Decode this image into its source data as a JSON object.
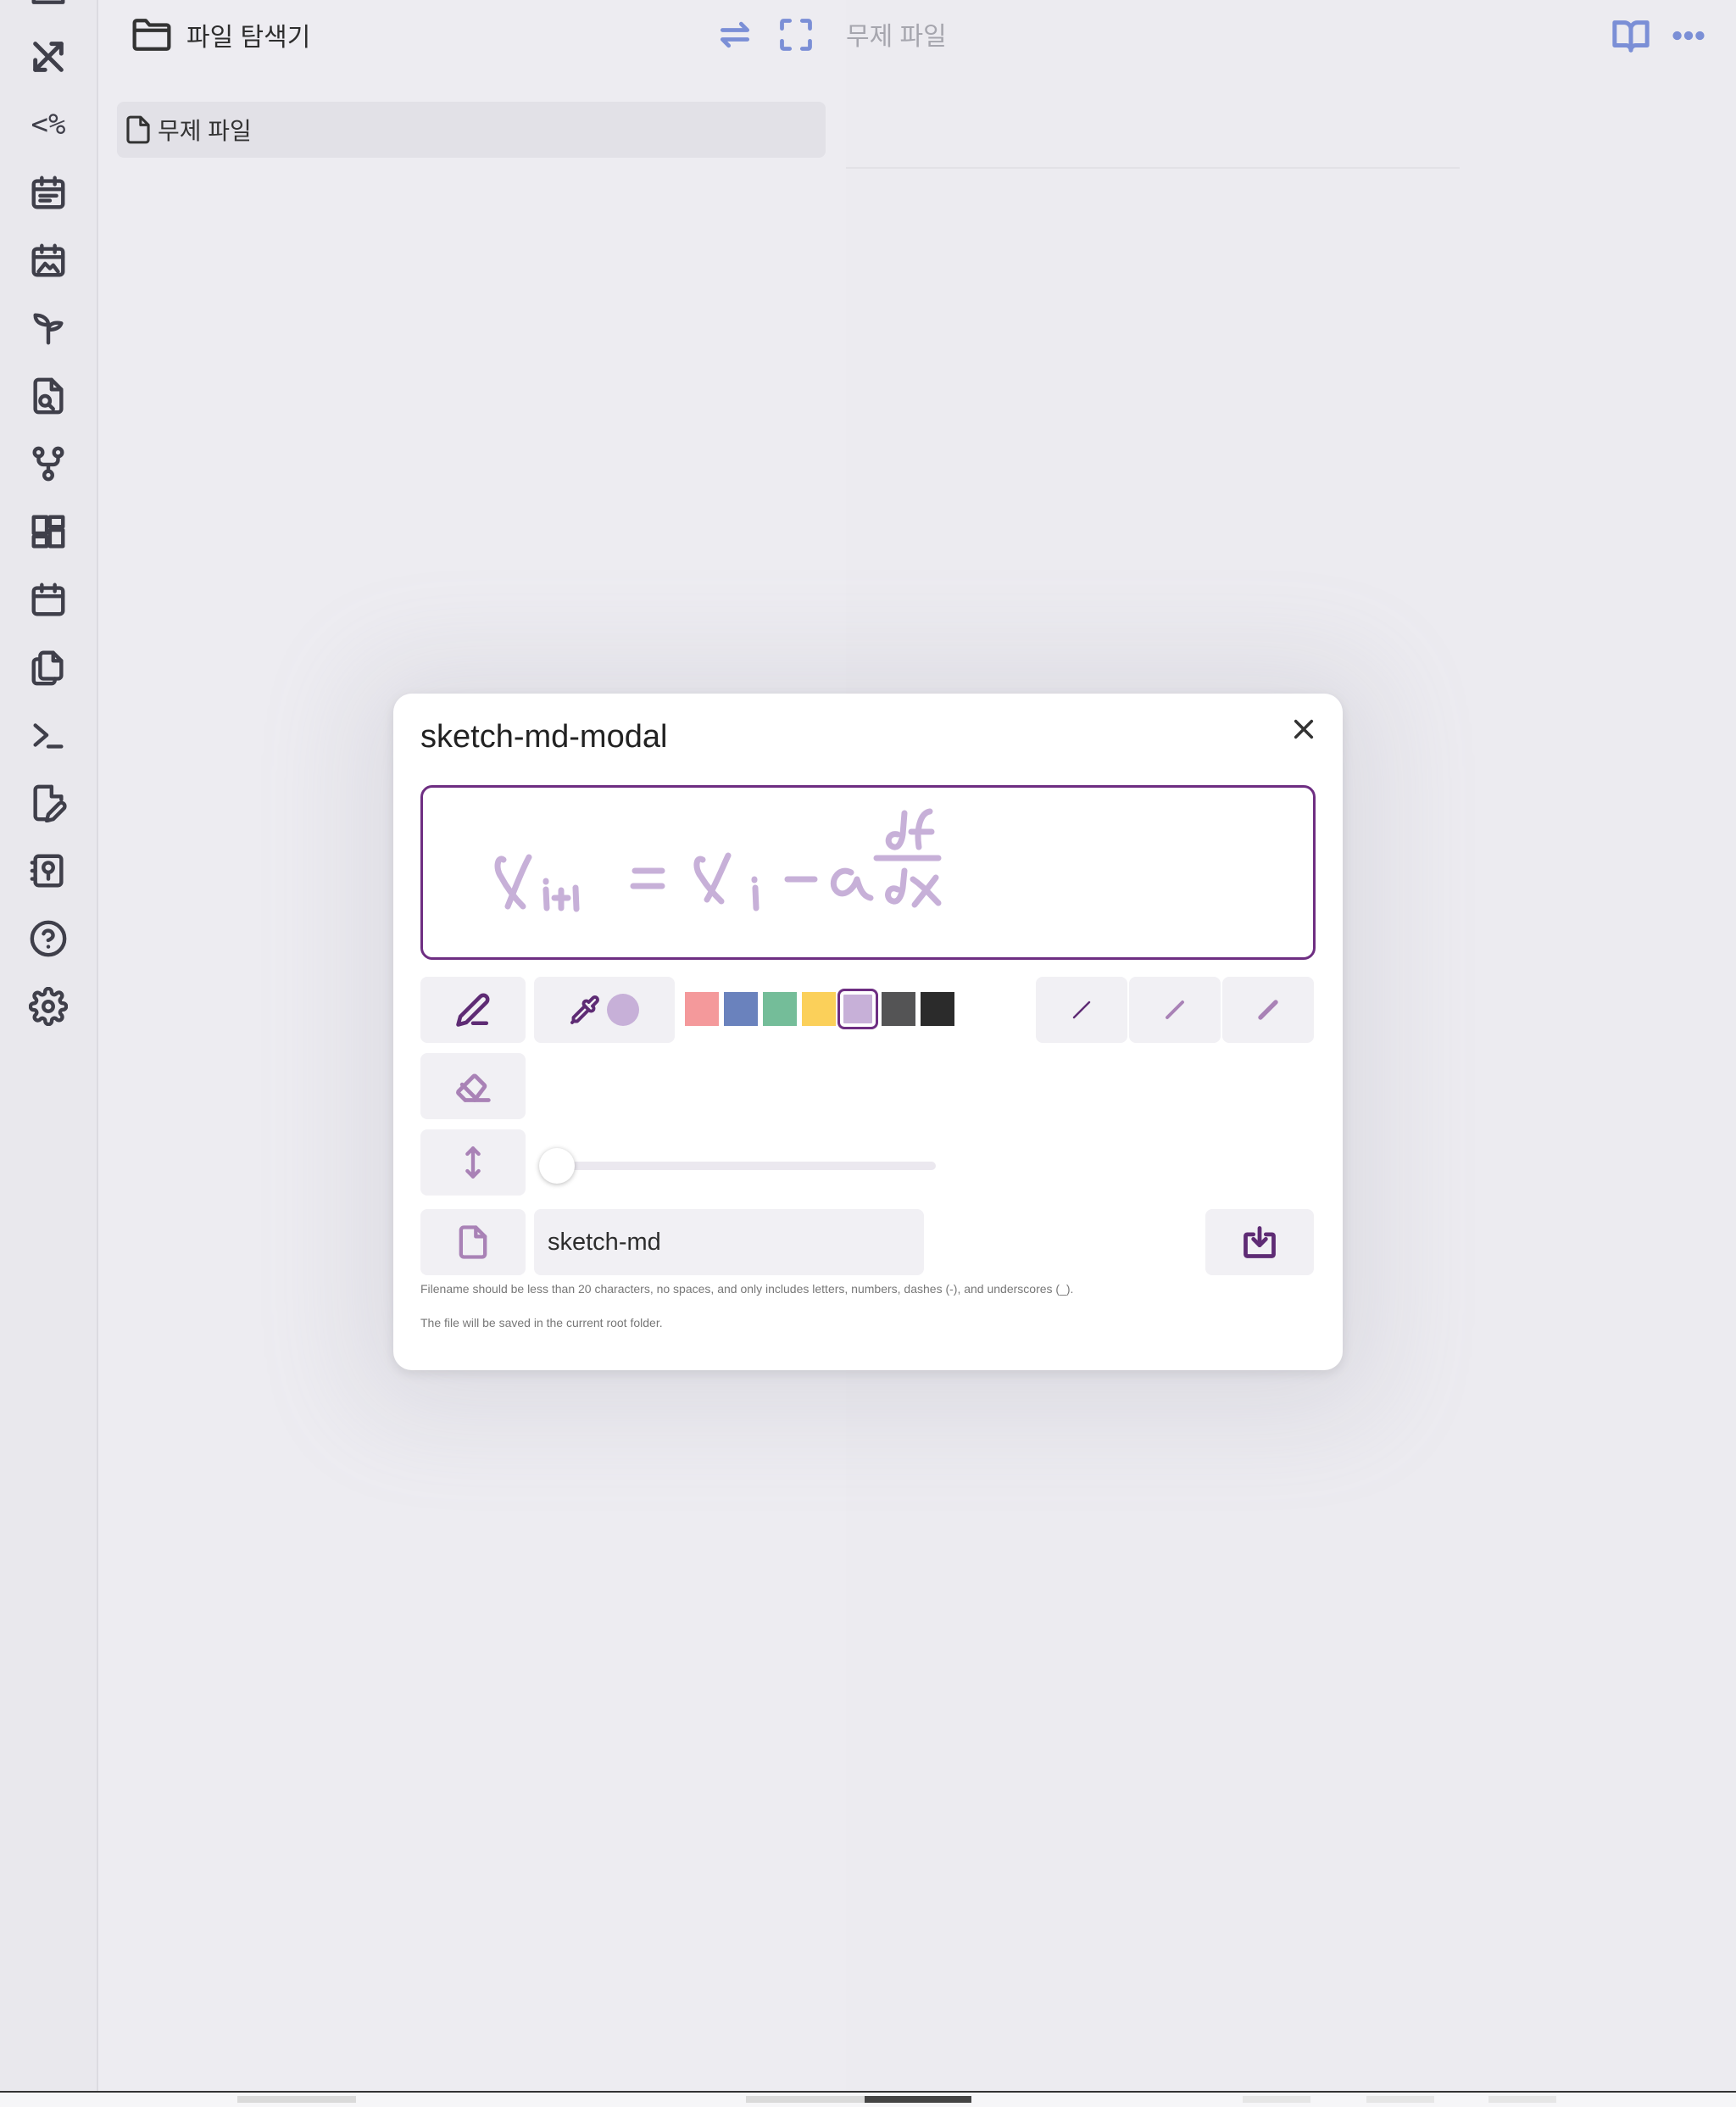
{
  "sidebar": {
    "title": "파일 탐색기",
    "file_item": "무제 파일"
  },
  "main": {
    "tab_title": "무제 파일"
  },
  "ribbon": {
    "templater_label": "<%"
  },
  "modal": {
    "title": "sketch-md-modal",
    "filename_value": "sketch-md",
    "hint_filename": "Filename should be less than 20 characters, no spaces, and only includes letters, numbers, dashes (-), and underscores (_).",
    "hint_location": "The file will be saved in the current root folder.",
    "palette": [
      "#f4999b",
      "#6a82bd",
      "#74bd99",
      "#fbd05a",
      "#c7b0d8",
      "#545455",
      "#2b2b2b"
    ],
    "selected_color": "#c7b0d8",
    "stroke_width_level": 0,
    "ink_color": "#c7b0d8"
  },
  "colors": {
    "accent": "#6e2e82",
    "header_icons": "#7b8fd6"
  }
}
